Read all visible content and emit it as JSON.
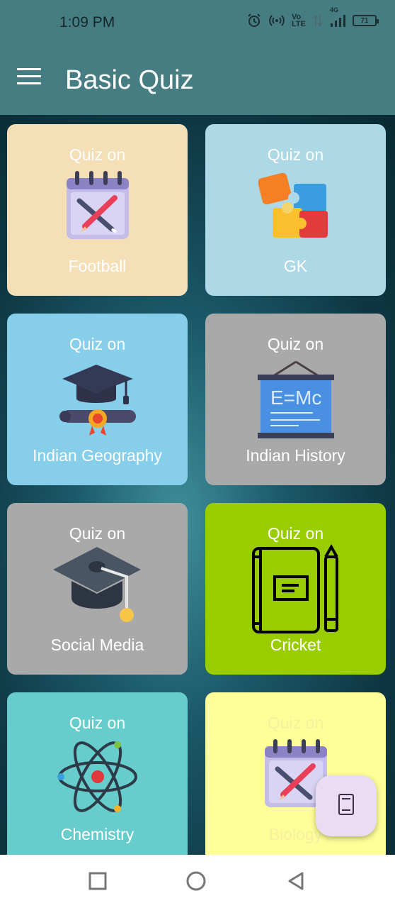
{
  "status_bar": {
    "time": "1:09 PM",
    "net_label": "4G",
    "volte_label": "Vo\nLTE",
    "battery_level": "71"
  },
  "app_bar": {
    "title": "Basic Quiz"
  },
  "cards": [
    {
      "pre": "Quiz on",
      "name": "Football",
      "bg": "#f5dfb6",
      "icon": "calendar-pencil-icon"
    },
    {
      "pre": "Quiz on",
      "name": "GK",
      "bg": "#add8e6",
      "icon": "puzzle-icon"
    },
    {
      "pre": "Quiz on",
      "name": "Indian Geography",
      "bg": "#87ceeb",
      "icon": "graduation-diploma-icon"
    },
    {
      "pre": "Quiz on",
      "name": "Indian History",
      "bg": "#a9a9a9",
      "icon": "blackboard-icon"
    },
    {
      "pre": "Quiz on",
      "name": "Social Media",
      "bg": "#a9a9a9",
      "icon": "graduation-cap-icon"
    },
    {
      "pre": "Quiz on",
      "name": "Cricket",
      "bg": "#9acd00",
      "icon": "notebook-pencil-icon"
    },
    {
      "pre": "Quiz on",
      "name": "Chemistry",
      "bg": "#66cdcc",
      "icon": "atom-icon"
    },
    {
      "pre": "Quiz on",
      "name": "Biology",
      "bg": "#ffff99",
      "icon": "calendar-pencil-icon"
    }
  ],
  "board_text": "E=Mc",
  "fab": {
    "icon": "book-icon"
  },
  "nav": {
    "recents": "square-icon",
    "home": "circle-icon",
    "back": "triangle-back-icon"
  }
}
